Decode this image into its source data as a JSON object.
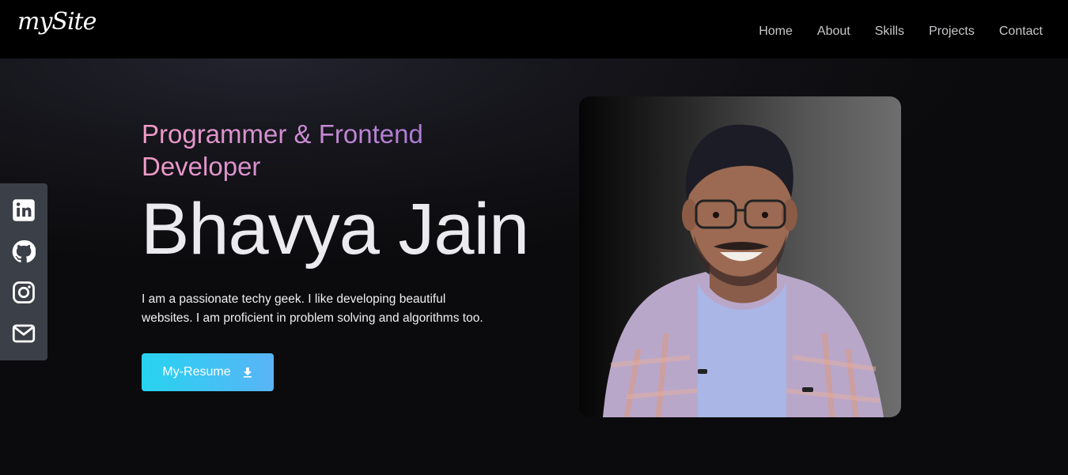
{
  "brand": {
    "logo": "mySite"
  },
  "nav": {
    "items": [
      {
        "label": "Home"
      },
      {
        "label": "About"
      },
      {
        "label": "Skills"
      },
      {
        "label": "Projects"
      },
      {
        "label": "Contact"
      }
    ]
  },
  "social": {
    "icons": [
      "linkedin-icon",
      "github-icon",
      "instagram-icon",
      "mail-icon"
    ]
  },
  "hero": {
    "subtitle": "Programmer & Frontend Developer",
    "name": "Bhavya Jain",
    "bio": "I am a passionate techy geek. I like developing beautiful websites. I am proficient in problem solving and algorithms too.",
    "resume_label": "My-Resume",
    "resume_icon": "download-icon"
  },
  "colors": {
    "navbar_bg": "#000000",
    "page_bg": "#0b0b0d",
    "social_bar_bg": "#3b3f47",
    "subtitle_gradient": [
      "#f29bc7",
      "#9d72d6"
    ],
    "button_gradient": [
      "#27d3ef",
      "#5ab4f7"
    ]
  }
}
